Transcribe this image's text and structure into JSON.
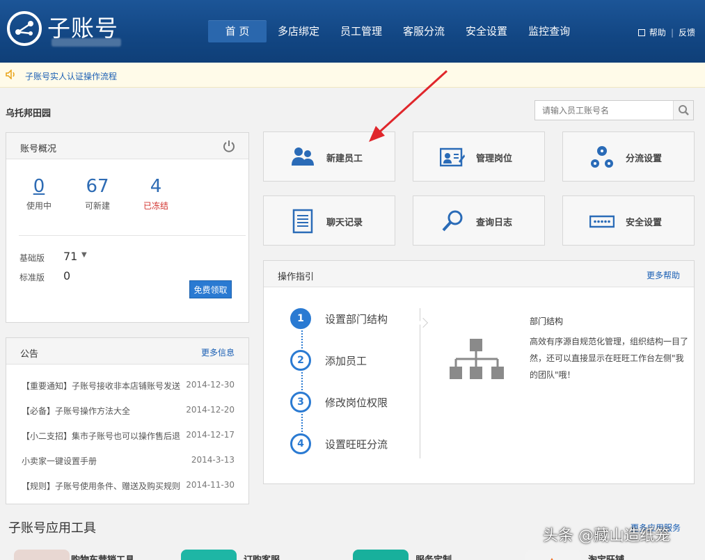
{
  "header": {
    "logo_text": "子账号",
    "nav": [
      "首 页",
      "多店绑定",
      "员工管理",
      "客服分流",
      "安全设置",
      "监控查询"
    ],
    "help": "帮助",
    "feedback": "反馈"
  },
  "notice": {
    "text": "子账号实人认证操作流程"
  },
  "shop": {
    "name": "乌托邦田园"
  },
  "search": {
    "placeholder": "请输入员工账号名"
  },
  "account": {
    "title": "账号概况",
    "stats": [
      {
        "value": "0",
        "label": "使用中"
      },
      {
        "value": "67",
        "label": "可新建"
      },
      {
        "value": "4",
        "label": "已冻结"
      }
    ],
    "versions": [
      {
        "label": "基础版",
        "value": "71"
      },
      {
        "label": "标准版",
        "value": "0"
      }
    ],
    "free_button": "免费领取"
  },
  "notices": {
    "title": "公告",
    "more": "更多信息",
    "items": [
      {
        "text": "【重要通知】子账号接收非本店铺账号发送",
        "date": "2014-12-30"
      },
      {
        "text": "【必备】子账号操作方法大全",
        "date": "2014-12-20"
      },
      {
        "text": "【小二支招】集市子账号也可以操作售后退",
        "date": "2014-12-17"
      },
      {
        "text": "小卖家一键设置手册",
        "date": "2014-3-13"
      },
      {
        "text": "【规则】子账号使用条件、赠送及购买规则",
        "date": "2014-11-30"
      }
    ]
  },
  "tiles": [
    {
      "label": "新建员工",
      "icon": "users-icon"
    },
    {
      "label": "管理岗位",
      "icon": "id-card-icon"
    },
    {
      "label": "分流设置",
      "icon": "flow-icon"
    },
    {
      "label": "聊天记录",
      "icon": "document-icon"
    },
    {
      "label": "查询日志",
      "icon": "search-icon"
    },
    {
      "label": "安全设置",
      "icon": "password-icon"
    }
  ],
  "guide": {
    "title": "操作指引",
    "more": "更多帮助",
    "steps": [
      {
        "num": "1",
        "label": "设置部门结构"
      },
      {
        "num": "2",
        "label": "添加员工"
      },
      {
        "num": "3",
        "label": "修改岗位权限"
      },
      {
        "num": "4",
        "label": "设置旺旺分流"
      }
    ],
    "detail_title": "部门结构",
    "detail_text": "高效有序源自规范化管理，组织结构一目了然，还可以直接显示在旺旺工作台左侧\"我的团队\"哦！"
  },
  "tools": {
    "title": "子账号应用工具",
    "more": "更多应用服务",
    "items": [
      "购物车营销工具",
      "订购客服",
      "服务定制",
      "淘宝旺铺"
    ]
  },
  "watermark": "头条 @藏山造纸笼",
  "colors": {
    "header": "#124683",
    "accent": "#2a7ad2",
    "link": "#1a5fb4",
    "frozen": "#d2322d"
  }
}
